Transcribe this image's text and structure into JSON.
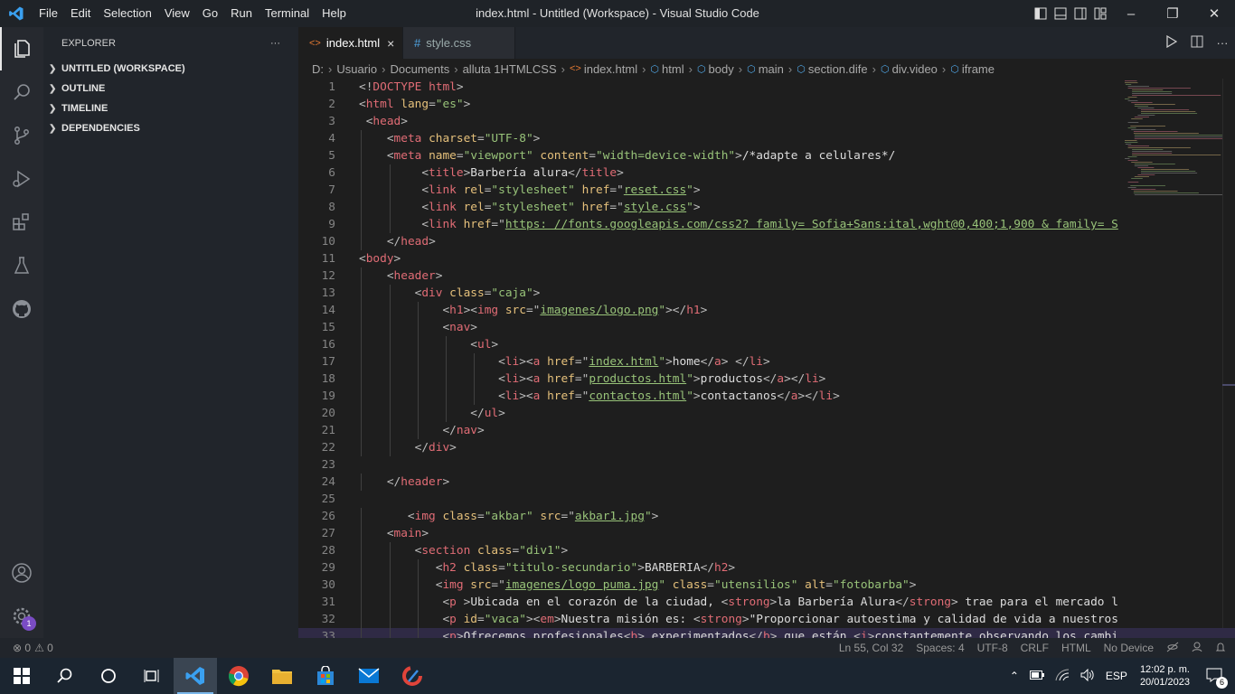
{
  "titlebar": {
    "menu": [
      "File",
      "Edit",
      "Selection",
      "View",
      "Go",
      "Run",
      "Terminal",
      "Help"
    ],
    "title": "index.html - Untitled (Workspace) - Visual Studio Code"
  },
  "activity": {
    "settings_badge": "1"
  },
  "sidebar": {
    "header": "EXPLORER",
    "more": "···",
    "sections": [
      "UNTITLED (WORKSPACE)",
      "OUTLINE",
      "TIMELINE",
      "DEPENDENCIES"
    ]
  },
  "tabs": [
    {
      "label": "index.html",
      "icon": "<>",
      "close": "×"
    },
    {
      "label": "style.css",
      "icon": "#"
    }
  ],
  "breadcrumb": {
    "folders": [
      "D:",
      "Usuario",
      "Documents",
      "alluta 1HTMLCSS"
    ],
    "file": "index.html",
    "symbols": [
      "html",
      "body",
      "main",
      "section.dife",
      "div.video",
      "iframe"
    ]
  },
  "code_lines": [
    {
      "n": "1",
      "ind": 0,
      "t": [
        [
          "p",
          "<!"
        ],
        [
          "t",
          "DOCTYPE"
        ],
        [
          "k",
          " html"
        ],
        [
          "p",
          ">"
        ]
      ]
    },
    {
      "n": "2",
      "ind": 0,
      "t": [
        [
          "p",
          "<"
        ],
        [
          "t",
          "html"
        ],
        [
          "a",
          " lang"
        ],
        [
          "p",
          "="
        ],
        [
          "s",
          "\"es\""
        ],
        [
          "p",
          ">"
        ]
      ]
    },
    {
      "n": "3",
      "ind": 0,
      "t": [
        [
          "p",
          " <"
        ],
        [
          "t",
          "head"
        ],
        [
          "p",
          ">"
        ]
      ]
    },
    {
      "n": "4",
      "ind": 1,
      "t": [
        [
          "p",
          "    <"
        ],
        [
          "t",
          "meta"
        ],
        [
          "a",
          " charset"
        ],
        [
          "p",
          "="
        ],
        [
          "s",
          "\"UTF-8\""
        ],
        [
          "p",
          ">"
        ]
      ]
    },
    {
      "n": "5",
      "ind": 1,
      "t": [
        [
          "p",
          "    <"
        ],
        [
          "t",
          "meta"
        ],
        [
          "a",
          " name"
        ],
        [
          "p",
          "="
        ],
        [
          "s",
          "\"viewport\""
        ],
        [
          "a",
          " content"
        ],
        [
          "p",
          "="
        ],
        [
          "s",
          "\"width=device-width\""
        ],
        [
          "p",
          ">"
        ],
        [
          "tx",
          "/*adapte a celulares*/"
        ]
      ]
    },
    {
      "n": "6",
      "ind": 2,
      "t": [
        [
          "p",
          "         <"
        ],
        [
          "t",
          "title"
        ],
        [
          "p",
          ">"
        ],
        [
          "tx",
          "Barbería alura"
        ],
        [
          "p",
          "</"
        ],
        [
          "t",
          "title"
        ],
        [
          "p",
          ">"
        ]
      ]
    },
    {
      "n": "7",
      "ind": 2,
      "t": [
        [
          "p",
          "         <"
        ],
        [
          "t",
          "link"
        ],
        [
          "a",
          " rel"
        ],
        [
          "p",
          "="
        ],
        [
          "s",
          "\"stylesheet\""
        ],
        [
          "a",
          " href"
        ],
        [
          "p",
          "=\""
        ],
        [
          "u",
          "reset.css"
        ],
        [
          "s",
          "\""
        ],
        [
          "p",
          ">"
        ]
      ]
    },
    {
      "n": "8",
      "ind": 2,
      "t": [
        [
          "p",
          "         <"
        ],
        [
          "t",
          "link"
        ],
        [
          "a",
          " rel"
        ],
        [
          "p",
          "="
        ],
        [
          "s",
          "\"stylesheet\""
        ],
        [
          "a",
          " href"
        ],
        [
          "p",
          "=\""
        ],
        [
          "u",
          "style.css"
        ],
        [
          "s",
          "\""
        ],
        [
          "p",
          ">"
        ]
      ]
    },
    {
      "n": "9",
      "ind": 2,
      "t": [
        [
          "p",
          "         <"
        ],
        [
          "t",
          "link"
        ],
        [
          "a",
          " href"
        ],
        [
          "p",
          "=\""
        ],
        [
          "u",
          "https: //fonts.googleapis.com/css2? family= Sofia+Sans:ital,wght@0,400;1,900 & family= S"
        ]
      ]
    },
    {
      "n": "10",
      "ind": 1,
      "t": [
        [
          "p",
          "    </"
        ],
        [
          "t",
          "head"
        ],
        [
          "p",
          ">"
        ]
      ]
    },
    {
      "n": "11",
      "ind": 0,
      "t": [
        [
          "p",
          "<"
        ],
        [
          "t",
          "body"
        ],
        [
          "p",
          ">"
        ]
      ]
    },
    {
      "n": "12",
      "ind": 1,
      "t": [
        [
          "p",
          "    <"
        ],
        [
          "t",
          "header"
        ],
        [
          "p",
          ">"
        ]
      ]
    },
    {
      "n": "13",
      "ind": 2,
      "t": [
        [
          "p",
          "        <"
        ],
        [
          "t",
          "div"
        ],
        [
          "a",
          " class"
        ],
        [
          "p",
          "="
        ],
        [
          "s",
          "\"caja\""
        ],
        [
          "p",
          ">"
        ]
      ]
    },
    {
      "n": "14",
      "ind": 3,
      "t": [
        [
          "p",
          "            <"
        ],
        [
          "t",
          "h1"
        ],
        [
          "p",
          "><"
        ],
        [
          "t",
          "img"
        ],
        [
          "a",
          " src"
        ],
        [
          "p",
          "=\""
        ],
        [
          "u",
          "imagenes/logo.png"
        ],
        [
          "s",
          "\""
        ],
        [
          "p",
          "></"
        ],
        [
          "t",
          "h1"
        ],
        [
          "p",
          ">"
        ]
      ]
    },
    {
      "n": "15",
      "ind": 3,
      "t": [
        [
          "p",
          "            <"
        ],
        [
          "t",
          "nav"
        ],
        [
          "p",
          ">"
        ]
      ]
    },
    {
      "n": "16",
      "ind": 4,
      "t": [
        [
          "p",
          "                <"
        ],
        [
          "t",
          "ul"
        ],
        [
          "p",
          ">"
        ]
      ]
    },
    {
      "n": "17",
      "ind": 5,
      "t": [
        [
          "p",
          "                    <"
        ],
        [
          "t",
          "li"
        ],
        [
          "p",
          "><"
        ],
        [
          "t",
          "a"
        ],
        [
          "a",
          " href"
        ],
        [
          "p",
          "=\""
        ],
        [
          "u",
          "index.html"
        ],
        [
          "s",
          "\""
        ],
        [
          "p",
          ">"
        ],
        [
          "tx",
          "home"
        ],
        [
          "p",
          "</"
        ],
        [
          "t",
          "a"
        ],
        [
          "p",
          "> </"
        ],
        [
          "t",
          "li"
        ],
        [
          "p",
          ">"
        ]
      ]
    },
    {
      "n": "18",
      "ind": 5,
      "t": [
        [
          "p",
          "                    <"
        ],
        [
          "t",
          "li"
        ],
        [
          "p",
          "><"
        ],
        [
          "t",
          "a"
        ],
        [
          "a",
          " href"
        ],
        [
          "p",
          "=\""
        ],
        [
          "u",
          "productos.html"
        ],
        [
          "s",
          "\""
        ],
        [
          "p",
          ">"
        ],
        [
          "tx",
          "productos"
        ],
        [
          "p",
          "</"
        ],
        [
          "t",
          "a"
        ],
        [
          "p",
          "></"
        ],
        [
          "t",
          "li"
        ],
        [
          "p",
          ">"
        ]
      ]
    },
    {
      "n": "19",
      "ind": 5,
      "t": [
        [
          "p",
          "                    <"
        ],
        [
          "t",
          "li"
        ],
        [
          "p",
          "><"
        ],
        [
          "t",
          "a"
        ],
        [
          "a",
          " href"
        ],
        [
          "p",
          "=\""
        ],
        [
          "u",
          "contactos.html"
        ],
        [
          "s",
          "\""
        ],
        [
          "p",
          ">"
        ],
        [
          "tx",
          "contactanos"
        ],
        [
          "p",
          "</"
        ],
        [
          "t",
          "a"
        ],
        [
          "p",
          "></"
        ],
        [
          "t",
          "li"
        ],
        [
          "p",
          ">"
        ]
      ]
    },
    {
      "n": "20",
      "ind": 4,
      "t": [
        [
          "p",
          "                </"
        ],
        [
          "t",
          "ul"
        ],
        [
          "p",
          ">"
        ]
      ]
    },
    {
      "n": "21",
      "ind": 3,
      "t": [
        [
          "p",
          "            </"
        ],
        [
          "t",
          "nav"
        ],
        [
          "p",
          ">"
        ]
      ]
    },
    {
      "n": "22",
      "ind": 2,
      "t": [
        [
          "p",
          "        </"
        ],
        [
          "t",
          "div"
        ],
        [
          "p",
          ">"
        ]
      ]
    },
    {
      "n": "23",
      "ind": 0,
      "t": []
    },
    {
      "n": "24",
      "ind": 1,
      "t": [
        [
          "p",
          "    </"
        ],
        [
          "t",
          "header"
        ],
        [
          "p",
          ">"
        ]
      ]
    },
    {
      "n": "25",
      "ind": 0,
      "t": []
    },
    {
      "n": "26",
      "ind": 1,
      "t": [
        [
          "p",
          "       <"
        ],
        [
          "t",
          "img"
        ],
        [
          "a",
          " class"
        ],
        [
          "p",
          "="
        ],
        [
          "s",
          "\"akbar\""
        ],
        [
          "a",
          " src"
        ],
        [
          "p",
          "=\""
        ],
        [
          "u",
          "akbar1.jpg"
        ],
        [
          "s",
          "\""
        ],
        [
          "p",
          ">"
        ]
      ]
    },
    {
      "n": "27",
      "ind": 1,
      "t": [
        [
          "p",
          "    <"
        ],
        [
          "t",
          "main"
        ],
        [
          "p",
          ">"
        ]
      ]
    },
    {
      "n": "28",
      "ind": 2,
      "t": [
        [
          "p",
          "        <"
        ],
        [
          "t",
          "section"
        ],
        [
          "a",
          " class"
        ],
        [
          "p",
          "="
        ],
        [
          "s",
          "\"div1\""
        ],
        [
          "p",
          ">"
        ]
      ]
    },
    {
      "n": "29",
      "ind": 3,
      "t": [
        [
          "p",
          "           <"
        ],
        [
          "t",
          "h2"
        ],
        [
          "a",
          " class"
        ],
        [
          "p",
          "="
        ],
        [
          "s",
          "\"titulo-secundario\""
        ],
        [
          "p",
          ">"
        ],
        [
          "tx",
          "BARBERIA"
        ],
        [
          "p",
          "</"
        ],
        [
          "t",
          "h2"
        ],
        [
          "p",
          ">"
        ]
      ]
    },
    {
      "n": "30",
      "ind": 3,
      "t": [
        [
          "p",
          "           <"
        ],
        [
          "t",
          "img"
        ],
        [
          "a",
          " src"
        ],
        [
          "p",
          "=\""
        ],
        [
          "u",
          "imagenes/logo puma.jpg"
        ],
        [
          "s",
          "\""
        ],
        [
          "a",
          " class"
        ],
        [
          "p",
          "="
        ],
        [
          "s",
          "\"utensilios\""
        ],
        [
          "a",
          " alt"
        ],
        [
          "p",
          "="
        ],
        [
          "s",
          "\"fotobarba\""
        ],
        [
          "p",
          ">"
        ]
      ]
    },
    {
      "n": "31",
      "ind": 3,
      "t": [
        [
          "p",
          "            <"
        ],
        [
          "t",
          "p"
        ],
        [
          "p",
          " >"
        ],
        [
          "tx",
          "Ubicada en el corazón de la ciudad, "
        ],
        [
          "p",
          "<"
        ],
        [
          "t",
          "strong"
        ],
        [
          "p",
          ">"
        ],
        [
          "tx",
          "la Barbería Alura"
        ],
        [
          "p",
          "</"
        ],
        [
          "t",
          "strong"
        ],
        [
          "p",
          "> "
        ],
        [
          "tx",
          "trae para el mercado l"
        ]
      ]
    },
    {
      "n": "32",
      "ind": 3,
      "t": [
        [
          "p",
          "            <"
        ],
        [
          "t",
          "p"
        ],
        [
          "a",
          " id"
        ],
        [
          "p",
          "="
        ],
        [
          "s",
          "\"vaca\""
        ],
        [
          "p",
          "><"
        ],
        [
          "t",
          "em"
        ],
        [
          "p",
          ">"
        ],
        [
          "tx",
          "Nuestra misión es: "
        ],
        [
          "p",
          "<"
        ],
        [
          "t",
          "strong"
        ],
        [
          "p",
          ">"
        ],
        [
          "tx",
          "\"Proporcionar autoestima y calidad de vida a nuestros"
        ]
      ]
    },
    {
      "n": "33",
      "ind": 3,
      "hl": true,
      "t": [
        [
          "p",
          "            <"
        ],
        [
          "t",
          "p"
        ],
        [
          "p",
          ">"
        ],
        [
          "tx",
          "Ofrecemos profesionales"
        ],
        [
          "p",
          "<"
        ],
        [
          "t",
          "b"
        ],
        [
          "p",
          "> "
        ],
        [
          "tx",
          "experimentados"
        ],
        [
          "p",
          "</"
        ],
        [
          "t",
          "b"
        ],
        [
          "p",
          "> "
        ],
        [
          "tx",
          "que están "
        ],
        [
          "p",
          "<"
        ],
        [
          "t",
          "i"
        ],
        [
          "p",
          ">"
        ],
        [
          "tx",
          "constantemente observando los cambi"
        ]
      ]
    }
  ],
  "status": {
    "errors": "⊗ 0",
    "warnings": "⚠ 0",
    "position": "Ln 55, Col 32",
    "spaces": "Spaces: 4",
    "encoding": "UTF-8",
    "eol": "CRLF",
    "language": "HTML",
    "device": "No Device"
  },
  "taskbar": {
    "lang": "ESP",
    "time": "12:02 p. m.",
    "date": "20/01/2023",
    "notifications": "6"
  },
  "colors": {
    "accent": "#007acc",
    "tag": "#e06c75",
    "attr": "#e5c07b",
    "string": "#98c379"
  }
}
